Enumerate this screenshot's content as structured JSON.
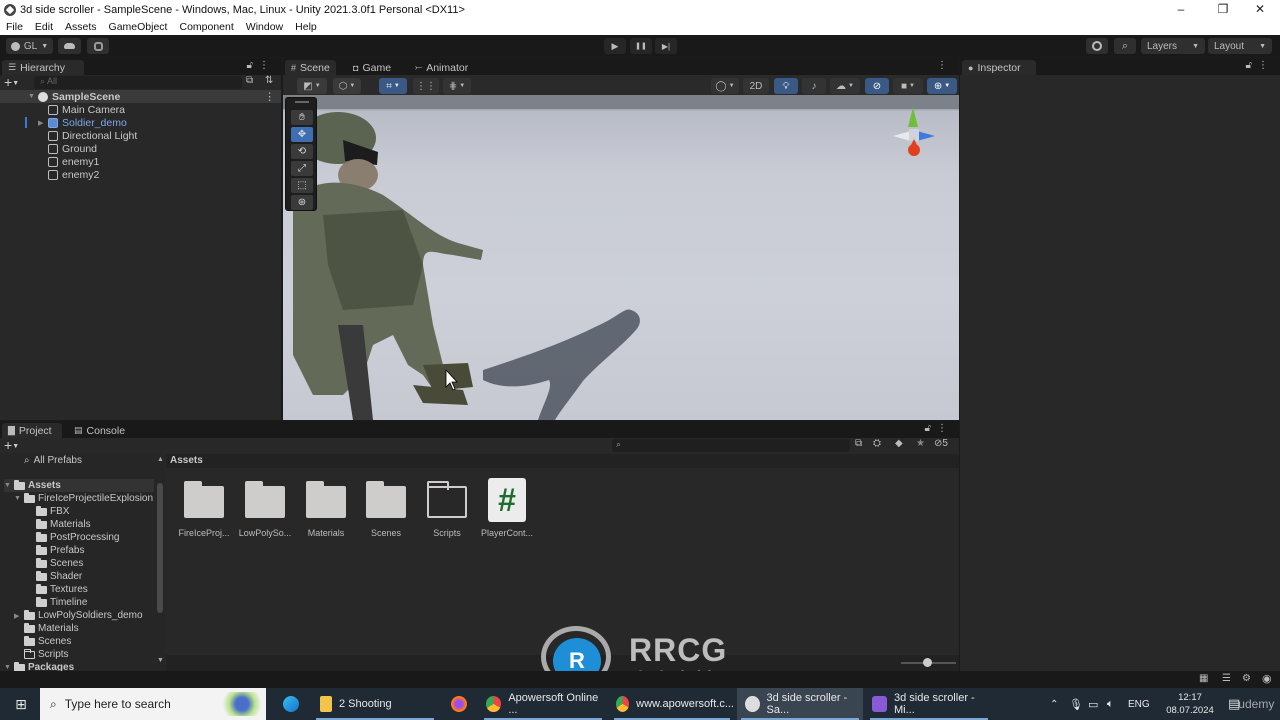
{
  "window": {
    "title": "3d side scroller - SampleScene - Windows, Mac, Linux - Unity 2021.3.0f1 Personal <DX11>",
    "controls": {
      "minimize": "–",
      "restore": "❐",
      "close": "✕"
    }
  },
  "menu": [
    "File",
    "Edit",
    "Assets",
    "GameObject",
    "Component",
    "Window",
    "Help"
  ],
  "toolbar": {
    "account_label": "GL",
    "account_icon": "user-icon",
    "cloud_icon": "cloud-icon",
    "collab_icon": "collab-icon",
    "play_icon": "▶",
    "pause_icon": "❚❚",
    "step_icon": "▶|",
    "history_icon": "history-icon",
    "search_icon": "search-icon",
    "layers_label": "Layers",
    "layout_label": "Layout"
  },
  "hierarchy": {
    "tab_label": "Hierarchy",
    "search_placeholder": "All",
    "scene_name": "SampleScene",
    "items": [
      {
        "label": "Main Camera",
        "selected": false
      },
      {
        "label": "Soldier_demo",
        "selected": true,
        "prefab": true,
        "expandable": true
      },
      {
        "label": "Directional Light",
        "selected": false
      },
      {
        "label": "Ground",
        "selected": false
      },
      {
        "label": "enemy1",
        "selected": false
      },
      {
        "label": "enemy2",
        "selected": false
      }
    ]
  },
  "scene_view": {
    "tabs": [
      {
        "label": "Scene",
        "icon": "grid-icon",
        "active": true
      },
      {
        "label": "Game",
        "icon": "gamepad-icon",
        "active": false
      },
      {
        "label": "Animator",
        "icon": "animator-icon",
        "active": false
      }
    ],
    "mode_2d_label": "2D",
    "tools": [
      "hand-tool",
      "move-tool",
      "rotate-tool",
      "scale-tool",
      "rect-tool",
      "transform-tool"
    ],
    "active_tool": "move-tool",
    "gizmo_axes": {
      "y": "#6fbf3a",
      "x": "#e0401e",
      "z": "#3d7be0"
    }
  },
  "inspector": {
    "tab_label": "Inspector"
  },
  "project": {
    "tabs": [
      {
        "label": "Project",
        "active": true
      },
      {
        "label": "Console",
        "active": false
      }
    ],
    "favorites": [
      "All Prefabs"
    ],
    "tree": [
      {
        "label": "Assets",
        "level": 0,
        "open": true,
        "bold": true
      },
      {
        "label": "FireIceProjectileExplosion",
        "level": 1,
        "open": true
      },
      {
        "label": "FBX",
        "level": 2
      },
      {
        "label": "Materials",
        "level": 2
      },
      {
        "label": "PostProcessing",
        "level": 2
      },
      {
        "label": "Prefabs",
        "level": 2
      },
      {
        "label": "Scenes",
        "level": 2
      },
      {
        "label": "Shader",
        "level": 2
      },
      {
        "label": "Textures",
        "level": 2
      },
      {
        "label": "Timeline",
        "level": 2
      },
      {
        "label": "LowPolySoldiers_demo",
        "level": 1,
        "expandable": true
      },
      {
        "label": "Materials",
        "level": 1
      },
      {
        "label": "Scenes",
        "level": 1
      },
      {
        "label": "Scripts",
        "level": 1,
        "empty": true
      },
      {
        "label": "Packages",
        "level": 0,
        "open": true,
        "bold": true
      }
    ],
    "breadcrumb": "Assets",
    "hidden_count": "5",
    "assets": [
      {
        "label": "FireIceProj...",
        "type": "folder"
      },
      {
        "label": "LowPolySo...",
        "type": "folder"
      },
      {
        "label": "Materials",
        "type": "folder"
      },
      {
        "label": "Scenes",
        "type": "folder"
      },
      {
        "label": "Scripts",
        "type": "empty-folder"
      },
      {
        "label": "PlayerCont...",
        "type": "csharp-script",
        "glyph": "#"
      }
    ],
    "icon_size_slider": 0.55
  },
  "watermark": {
    "brand": "RRCG",
    "subtitle": "人人素材"
  },
  "taskbar": {
    "search_placeholder": "Type here to search",
    "items": [
      {
        "label": "",
        "icon": "edge-icon"
      },
      {
        "label": "2 Shooting",
        "icon": "file-explorer-icon"
      },
      {
        "label": "",
        "icon": "firefox-icon"
      },
      {
        "label": "Apowersoft Online ...",
        "icon": "chrome-icon"
      },
      {
        "label": "www.apowersoft.c...",
        "icon": "chrome-icon"
      },
      {
        "label": "3d side scroller - Sa...",
        "icon": "unity-icon"
      },
      {
        "label": "3d side scroller - Mi...",
        "icon": "visual-studio-icon"
      }
    ],
    "tray": {
      "language": "ENG",
      "time": "12:17",
      "date": "08.07.2024"
    },
    "overlay": "udemy"
  }
}
